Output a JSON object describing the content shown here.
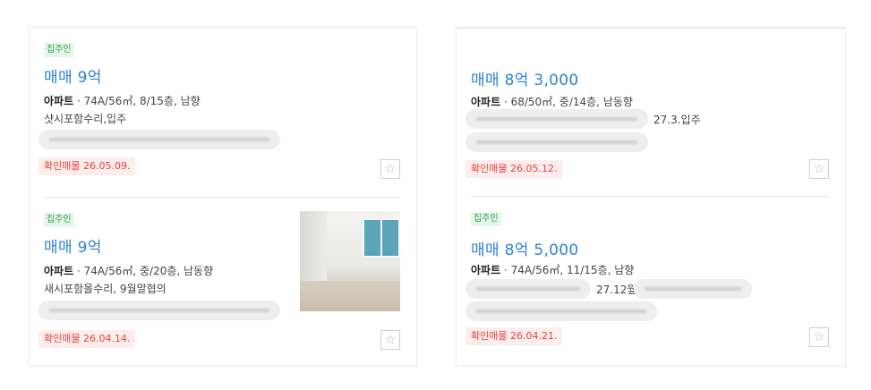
{
  "listings_left": [
    {
      "badge": "집주인",
      "price": "매매 9억",
      "type": "아파트",
      "info": " · 74A/56㎡, 8/15층, 남향",
      "desc": "샷시포함수리,입주",
      "confirm": "확인매물 26.05.09."
    },
    {
      "badge": "집주인",
      "price": "매매 9억",
      "type": "아파트",
      "info": " · 74A/56㎡, 중/20층, 남동향",
      "desc": "새시포함올수리, 9월말협의",
      "confirm": "확인매물 26.04.14."
    }
  ],
  "listings_right": [
    {
      "price": "매매 8억 3,000",
      "type": "아파트",
      "info": " · 68/50㎡, 중/14층, 남동향",
      "desc_visible": "27.3.입주",
      "confirm": "확인매물 26.05.12."
    },
    {
      "badge": "집주인",
      "price": "매매 8억 5,000",
      "type": "아파트",
      "info": " · 74A/56㎡, 11/15층, 남향",
      "desc_visible": "27.12월",
      "confirm": "확인매물 26.04.21."
    }
  ],
  "icons": {
    "favorite": "star-outline-icon"
  },
  "colors": {
    "price": "#2d82d6",
    "badge_text": "#2e9b4a",
    "confirm_text": "#e8423a"
  }
}
